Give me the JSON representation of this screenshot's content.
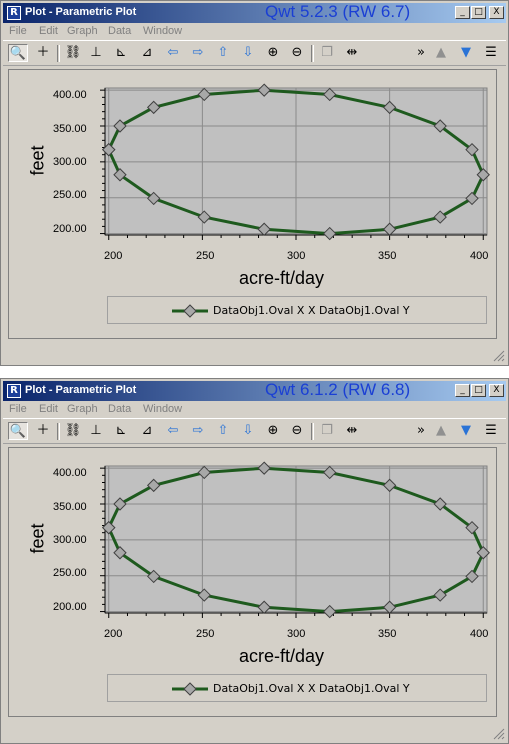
{
  "windows": [
    {
      "title": "Plot - Parametric Plot",
      "version": "Qwt 5.2.3 (RW 6.7)",
      "menu": [
        "File",
        "Edit",
        "Graph",
        "Data",
        "Window"
      ],
      "window_buttons": [
        "_",
        "□",
        "X"
      ],
      "toolbar_icons": [
        "zoom-icon",
        "crosshair-icon",
        "link-icon",
        "axis-icon",
        "axis-right-icon",
        "axis-scale-icon",
        "arrow-left-icon",
        "arrow-right-icon",
        "arrow-up-icon",
        "arrow-down-icon",
        "zoom-in-icon",
        "zoom-out-icon",
        "copy-icon",
        "split-icon",
        "overflow-icon",
        "fill-up-icon",
        "fill-down-icon",
        "list-icon"
      ],
      "yaxis_label": "feet",
      "xaxis_label": "acre-ft/day",
      "yticks": [
        "400.00",
        "350.00",
        "300.00",
        "250.00",
        "200.00"
      ],
      "xticks": [
        "200",
        "250",
        "300",
        "350",
        "400"
      ],
      "legend_label": "DataObj1.Oval X X DataObj1.Oval Y",
      "colors": {
        "series": "#1e5a1e",
        "marker": "#a8a8a8",
        "plot_bg": "#c0c0c0"
      }
    },
    {
      "title": "Plot - Parametric Plot",
      "version": "Qwt 6.1.2 (RW 6.8)",
      "menu": [
        "File",
        "Edit",
        "Graph",
        "Data",
        "Window"
      ],
      "window_buttons": [
        "_",
        "□",
        "X"
      ],
      "toolbar_icons": [
        "zoom-icon",
        "crosshair-icon",
        "link-icon",
        "axis-icon",
        "axis-right-icon",
        "axis-scale-icon",
        "arrow-left-icon",
        "arrow-right-icon",
        "arrow-up-icon",
        "arrow-down-icon",
        "zoom-in-icon",
        "zoom-out-icon",
        "copy-icon",
        "split-icon",
        "overflow-icon",
        "fill-up-icon",
        "fill-down-icon",
        "list-icon"
      ],
      "yaxis_label": "feet",
      "xaxis_label": "acre-ft/day",
      "yticks": [
        "400.00",
        "350.00",
        "300.00",
        "250.00",
        "200.00"
      ],
      "xticks": [
        "200",
        "250",
        "300",
        "350",
        "400"
      ],
      "legend_label": "DataObj1.Oval X X DataObj1.Oval Y",
      "colors": {
        "series": "#1e5a1e",
        "marker": "#a8a8a8",
        "plot_bg": "#c0c0c0"
      }
    }
  ],
  "chart_data": [
    {
      "type": "line",
      "xlabel": "acre-ft/day",
      "ylabel": "feet",
      "xlim": [
        198,
        402
      ],
      "ylim": [
        198,
        403
      ],
      "grid": true,
      "legend": "bottom",
      "series": [
        {
          "name": "DataObj1.Oval X X DataObj1.Oval Y",
          "x": [
            200,
            206,
            224,
            251,
            283,
            318,
            350,
            377,
            394,
            400,
            394,
            377,
            350,
            318,
            283,
            251,
            224,
            206,
            200
          ],
          "y": [
            317,
            350,
            376,
            394,
            400,
            394,
            376,
            350,
            317,
            282,
            249,
            223,
            206,
            200,
            206,
            223,
            249,
            282,
            317
          ]
        }
      ]
    },
    {
      "type": "line",
      "xlabel": "acre-ft/day",
      "ylabel": "feet",
      "xlim": [
        198,
        402
      ],
      "ylim": [
        198,
        403
      ],
      "grid": true,
      "legend": "bottom",
      "series": [
        {
          "name": "DataObj1.Oval X X DataObj1.Oval Y",
          "x": [
            200,
            206,
            224,
            251,
            283,
            318,
            350,
            377,
            394,
            400,
            394,
            377,
            350,
            318,
            283,
            251,
            224,
            206,
            200
          ],
          "y": [
            317,
            350,
            376,
            394,
            400,
            394,
            376,
            350,
            317,
            282,
            249,
            223,
            206,
            200,
            206,
            223,
            249,
            282,
            317
          ]
        }
      ]
    }
  ]
}
